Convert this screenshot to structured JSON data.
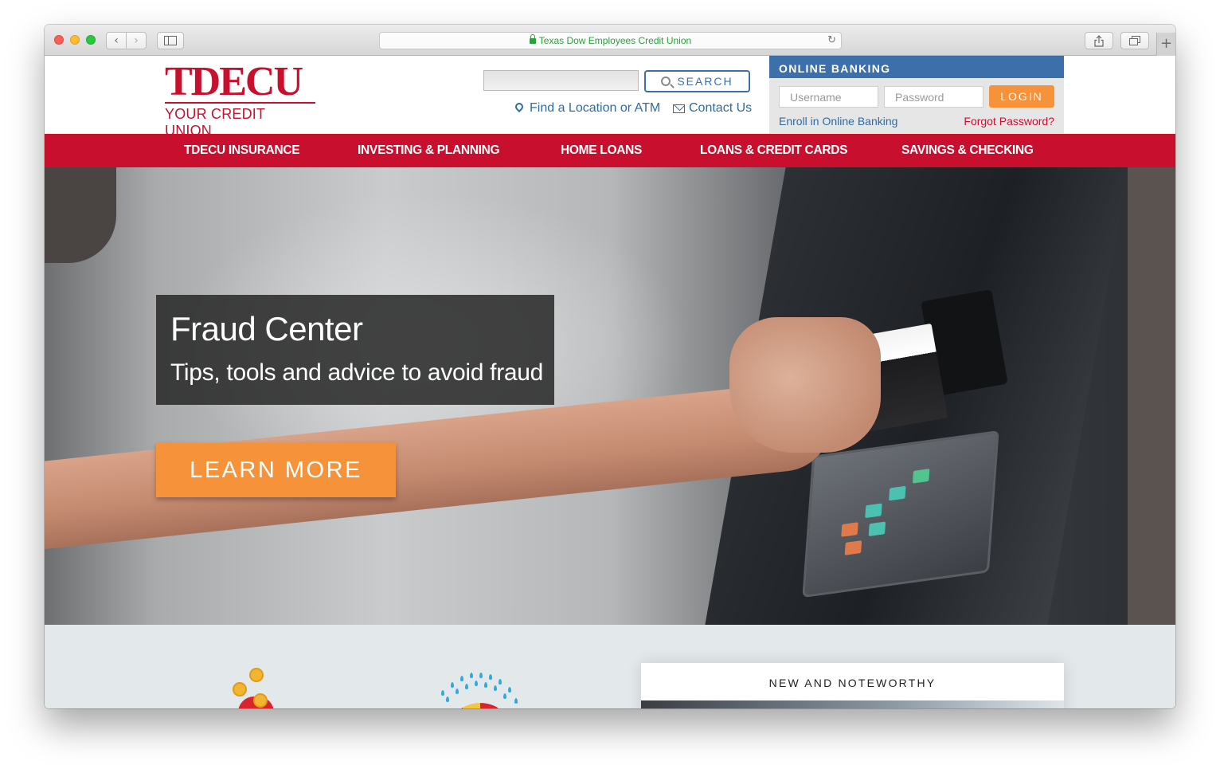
{
  "browser": {
    "address": "Texas Dow Employees Credit Union",
    "back_glyph": "‹",
    "forward_glyph": "›",
    "newtab_glyph": "+",
    "reload_glyph": "↻"
  },
  "header": {
    "logo_word": "TDECU",
    "logo_tagline": "YOUR CREDIT UNION",
    "search_value": "",
    "search_label": "SEARCH",
    "find_location": "Find a Location or ATM",
    "contact": "Contact Us"
  },
  "online_banking": {
    "title": "ONLINE BANKING",
    "username_placeholder": "Username",
    "password_placeholder": "Password",
    "login_label": "LOGIN",
    "enroll": "Enroll in Online Banking",
    "forgot": "Forgot Password?"
  },
  "nav": {
    "items": [
      "TDECU INSURANCE",
      "INVESTING & PLANNING",
      "HOME LOANS",
      "LOANS & CREDIT CARDS",
      "SAVINGS & CHECKING"
    ]
  },
  "hero": {
    "title": "Fraud Center",
    "subtitle": "Tips, tools and advice to avoid fraud",
    "cta": "LEARN MORE"
  },
  "lower": {
    "new_and_noteworthy": "NEW AND NOTEWORTHY"
  },
  "colors": {
    "brand_red": "#c8102e",
    "link_blue": "#2e6ca4",
    "accent_orange": "#f6923a",
    "banking_blue": "#3d6fab"
  }
}
